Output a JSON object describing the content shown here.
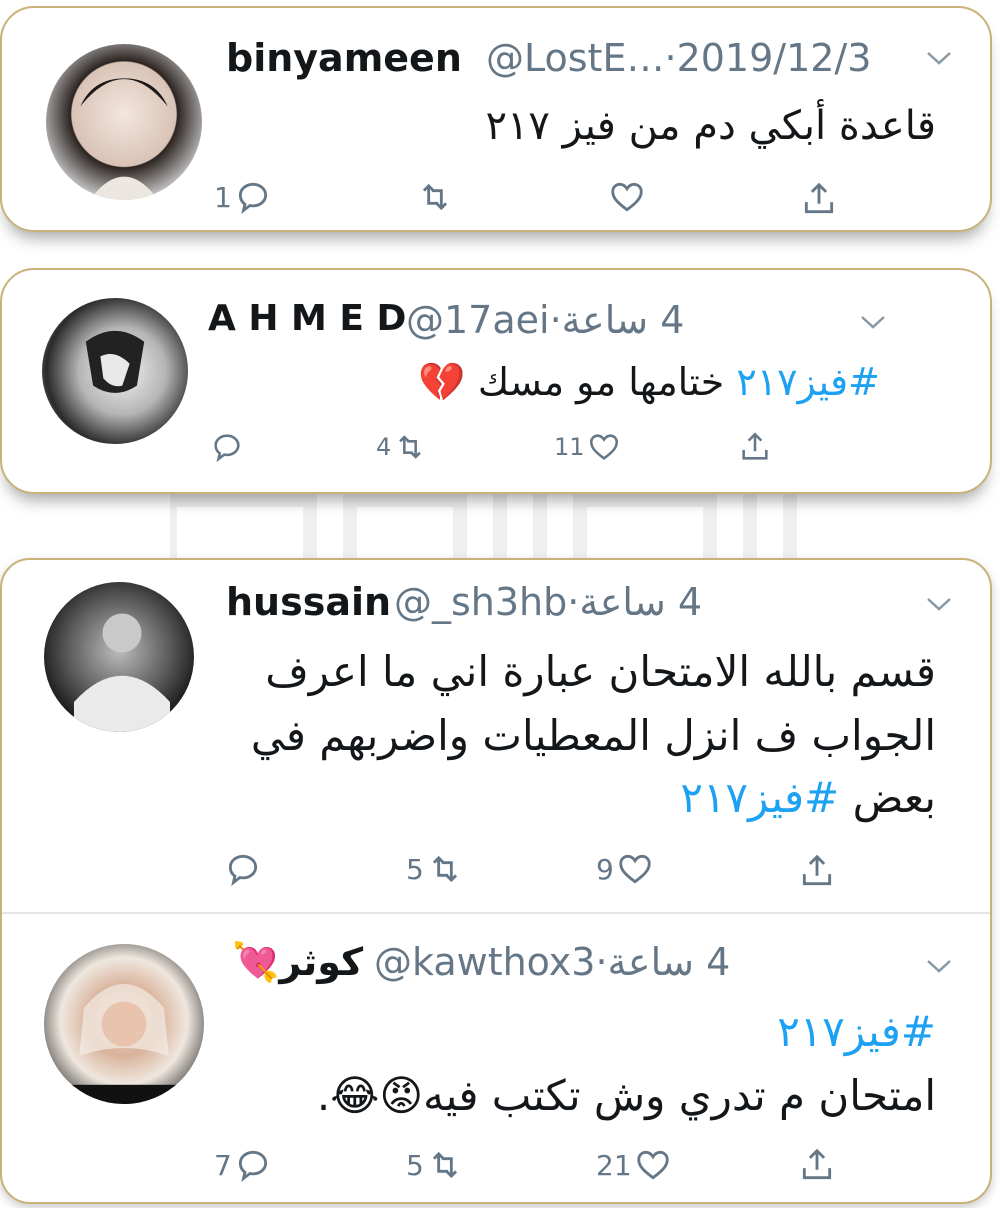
{
  "colors": {
    "accent": "#1da1f2",
    "muted": "#657786",
    "border": "#c9b27a"
  },
  "tweets": [
    {
      "name": "binyameen",
      "handle": "@LostE…",
      "sep": "·",
      "time": "2019/12/3",
      "text": "قاعدة أبكي دم من فيز ٢١٧",
      "hashtag": "",
      "reply_count": "1",
      "retweet_count": "",
      "like_count": ""
    },
    {
      "name": "A H M E D",
      "handle": "@17aei",
      "sep": "·",
      "time": "4 ساعة",
      "hashtag": "#فيز٢١٧",
      "text": "ختامها مو مسك",
      "emoji": "💔",
      "reply_count": "",
      "retweet_count": "4",
      "like_count": "11"
    },
    {
      "name": "hussain",
      "handle": "@_sh3hb",
      "sep": "·",
      "time": "4 ساعة",
      "line1": "قسم بالله الامتحان عبارة اني ما اعرف",
      "line2": "الجواب ف انزل المعطيات واضربهم في",
      "line3": "بعض",
      "hashtag": "#فيز٢١٧",
      "reply_count": "",
      "retweet_count": "5",
      "like_count": "9"
    },
    {
      "name": "كوثر",
      "name_emoji": "💘",
      "handle": "@kawthox3",
      "sep": "·",
      "time": "4 ساعة",
      "hashtag": "#فيز٢١٧",
      "text": "امتحان م تدري وش تكتب فيه",
      "emoji": "😡😂",
      "tail": ".",
      "reply_count": "7",
      "retweet_count": "5",
      "like_count": "21"
    }
  ]
}
